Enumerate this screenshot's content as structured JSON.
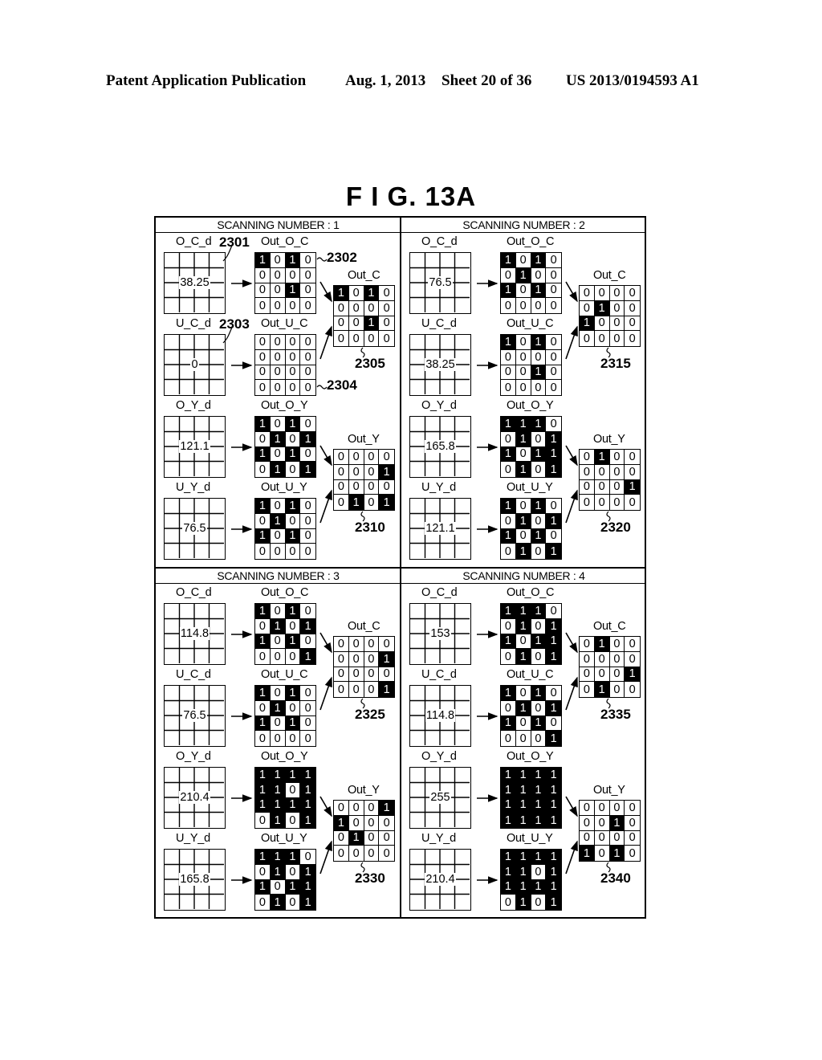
{
  "header": {
    "publication": "Patent Application Publication",
    "date": "Aug. 1, 2013",
    "sheet": "Sheet 20 of 36",
    "number": "US 2013/0194593 A1"
  },
  "figure": {
    "title": "F I G.  13A"
  },
  "labels": {
    "O_C_d": "O_C_d",
    "U_C_d": "U_C_d",
    "O_Y_d": "O_Y_d",
    "U_Y_d": "U_Y_d",
    "Out_O_C": "Out_O_C",
    "Out_U_C": "Out_U_C",
    "Out_O_Y": "Out_O_Y",
    "Out_U_Y": "Out_U_Y",
    "Out_C": "Out_C",
    "Out_Y": "Out_Y"
  },
  "panels": [
    {
      "title": "SCANNING NUMBER : 1",
      "refs": {
        "o_c_d": "2301",
        "out_o_c": "2302",
        "u_c_d": "2303",
        "out_u_c": "2304",
        "out_c": "2305",
        "out_y": "2310"
      },
      "O_C_d": "38.25",
      "U_C_d": "0",
      "O_Y_d": "121.1",
      "U_Y_d": "76.5",
      "Out_O_C": [
        [
          1,
          0,
          1,
          0
        ],
        [
          0,
          0,
          0,
          0
        ],
        [
          0,
          0,
          1,
          0
        ],
        [
          0,
          0,
          0,
          0
        ]
      ],
      "Out_U_C": [
        [
          0,
          0,
          0,
          0
        ],
        [
          0,
          0,
          0,
          0
        ],
        [
          0,
          0,
          0,
          0
        ],
        [
          0,
          0,
          0,
          0
        ]
      ],
      "Out_C": [
        [
          1,
          0,
          1,
          0
        ],
        [
          0,
          0,
          0,
          0
        ],
        [
          0,
          0,
          1,
          0
        ],
        [
          0,
          0,
          0,
          0
        ]
      ],
      "Out_O_Y": [
        [
          1,
          0,
          1,
          0
        ],
        [
          0,
          1,
          0,
          1
        ],
        [
          1,
          0,
          1,
          0
        ],
        [
          0,
          1,
          0,
          1
        ]
      ],
      "Out_U_Y": [
        [
          1,
          0,
          1,
          0
        ],
        [
          0,
          1,
          0,
          0
        ],
        [
          1,
          0,
          1,
          0
        ],
        [
          0,
          0,
          0,
          0
        ]
      ],
      "Out_Y": [
        [
          0,
          0,
          0,
          0
        ],
        [
          0,
          0,
          0,
          1
        ],
        [
          0,
          0,
          0,
          0
        ],
        [
          0,
          1,
          0,
          1
        ]
      ]
    },
    {
      "title": "SCANNING NUMBER : 2",
      "refs": {
        "out_c": "2315",
        "out_y": "2320"
      },
      "O_C_d": "76.5",
      "U_C_d": "38.25",
      "O_Y_d": "165.8",
      "U_Y_d": "121.1",
      "Out_O_C": [
        [
          1,
          0,
          1,
          0
        ],
        [
          0,
          1,
          0,
          0
        ],
        [
          1,
          0,
          1,
          0
        ],
        [
          0,
          0,
          0,
          0
        ]
      ],
      "Out_U_C": [
        [
          1,
          0,
          1,
          0
        ],
        [
          0,
          0,
          0,
          0
        ],
        [
          0,
          0,
          1,
          0
        ],
        [
          0,
          0,
          0,
          0
        ]
      ],
      "Out_C": [
        [
          0,
          0,
          0,
          0
        ],
        [
          0,
          1,
          0,
          0
        ],
        [
          1,
          0,
          0,
          0
        ],
        [
          0,
          0,
          0,
          0
        ]
      ],
      "Out_O_Y": [
        [
          1,
          1,
          1,
          0
        ],
        [
          0,
          1,
          0,
          1
        ],
        [
          1,
          0,
          1,
          1
        ],
        [
          0,
          1,
          0,
          1
        ]
      ],
      "Out_U_Y": [
        [
          1,
          0,
          1,
          0
        ],
        [
          0,
          1,
          0,
          1
        ],
        [
          1,
          0,
          1,
          0
        ],
        [
          0,
          1,
          0,
          1
        ]
      ],
      "Out_Y": [
        [
          0,
          1,
          0,
          0
        ],
        [
          0,
          0,
          0,
          0
        ],
        [
          0,
          0,
          0,
          1
        ],
        [
          0,
          0,
          0,
          0
        ]
      ]
    },
    {
      "title": "SCANNING NUMBER : 3",
      "refs": {
        "out_c": "2325",
        "out_y": "2330"
      },
      "O_C_d": "114.8",
      "U_C_d": "76.5",
      "O_Y_d": "210.4",
      "U_Y_d": "165.8",
      "Out_O_C": [
        [
          1,
          0,
          1,
          0
        ],
        [
          0,
          1,
          0,
          1
        ],
        [
          1,
          0,
          1,
          0
        ],
        [
          0,
          0,
          0,
          1
        ]
      ],
      "Out_U_C": [
        [
          1,
          0,
          1,
          0
        ],
        [
          0,
          1,
          0,
          0
        ],
        [
          1,
          0,
          1,
          0
        ],
        [
          0,
          0,
          0,
          0
        ]
      ],
      "Out_C": [
        [
          0,
          0,
          0,
          0
        ],
        [
          0,
          0,
          0,
          1
        ],
        [
          0,
          0,
          0,
          0
        ],
        [
          0,
          0,
          0,
          1
        ]
      ],
      "Out_O_Y": [
        [
          1,
          1,
          1,
          1
        ],
        [
          1,
          1,
          0,
          1
        ],
        [
          1,
          1,
          1,
          1
        ],
        [
          0,
          1,
          0,
          1
        ]
      ],
      "Out_U_Y": [
        [
          1,
          1,
          1,
          0
        ],
        [
          0,
          1,
          0,
          1
        ],
        [
          1,
          0,
          1,
          1
        ],
        [
          0,
          1,
          0,
          1
        ]
      ],
      "Out_Y": [
        [
          0,
          0,
          0,
          1
        ],
        [
          1,
          0,
          0,
          0
        ],
        [
          0,
          1,
          0,
          0
        ],
        [
          0,
          0,
          0,
          0
        ]
      ]
    },
    {
      "title": "SCANNING NUMBER : 4",
      "refs": {
        "out_c": "2335",
        "out_y": "2340"
      },
      "O_C_d": "153",
      "U_C_d": "114.8",
      "O_Y_d": "255",
      "U_Y_d": "210.4",
      "Out_O_C": [
        [
          1,
          1,
          1,
          0
        ],
        [
          0,
          1,
          0,
          1
        ],
        [
          1,
          0,
          1,
          1
        ],
        [
          0,
          1,
          0,
          1
        ]
      ],
      "Out_U_C": [
        [
          1,
          0,
          1,
          0
        ],
        [
          0,
          1,
          0,
          1
        ],
        [
          1,
          0,
          1,
          0
        ],
        [
          0,
          0,
          0,
          1
        ]
      ],
      "Out_C": [
        [
          0,
          1,
          0,
          0
        ],
        [
          0,
          0,
          0,
          0
        ],
        [
          0,
          0,
          0,
          1
        ],
        [
          0,
          1,
          0,
          0
        ]
      ],
      "Out_O_Y": [
        [
          1,
          1,
          1,
          1
        ],
        [
          1,
          1,
          1,
          1
        ],
        [
          1,
          1,
          1,
          1
        ],
        [
          1,
          1,
          1,
          1
        ]
      ],
      "Out_U_Y": [
        [
          1,
          1,
          1,
          1
        ],
        [
          1,
          1,
          0,
          1
        ],
        [
          1,
          1,
          1,
          1
        ],
        [
          0,
          1,
          0,
          1
        ]
      ],
      "Out_Y": [
        [
          0,
          0,
          0,
          0
        ],
        [
          0,
          0,
          1,
          0
        ],
        [
          0,
          0,
          0,
          0
        ],
        [
          1,
          0,
          1,
          0
        ]
      ]
    }
  ]
}
